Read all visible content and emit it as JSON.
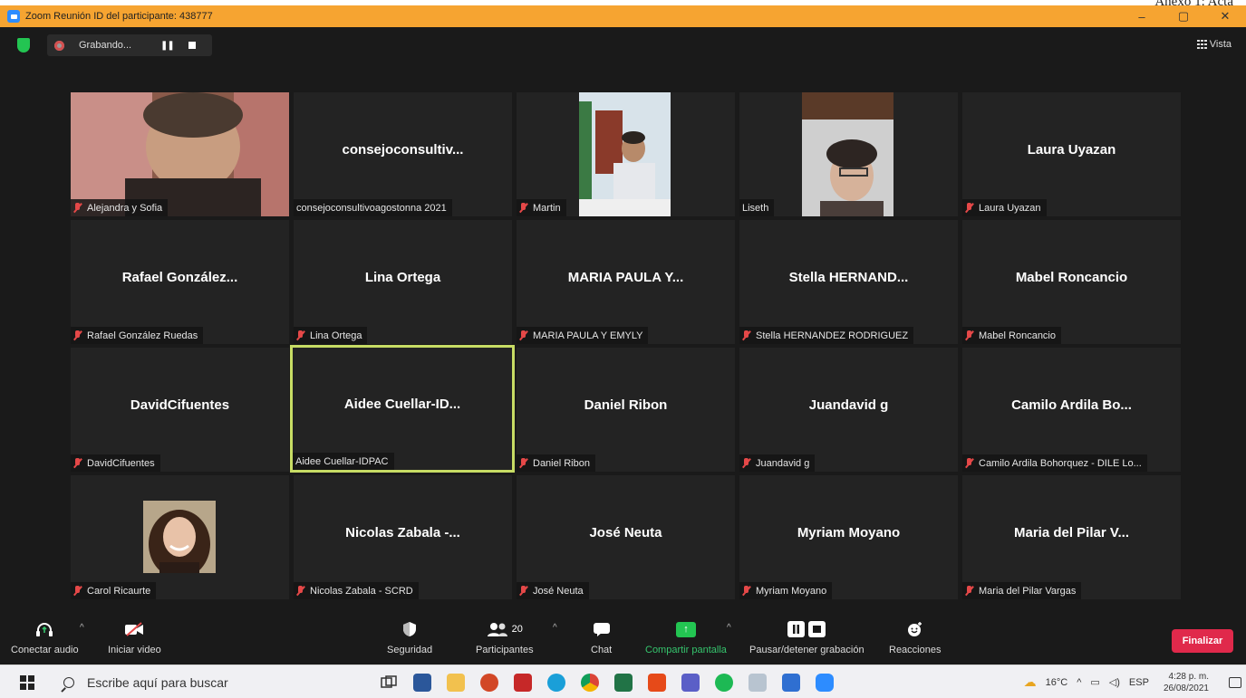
{
  "window": {
    "doc_text": "Anexo 1: Acta",
    "title": "Zoom Reunión ID del participante: 438777",
    "min": "–",
    "max": "▢",
    "close": "✕"
  },
  "top_bar": {
    "recording_text": "Grabando...",
    "view_label": "Vista"
  },
  "tiles": [
    {
      "title": "",
      "label": "Alejandra y Sofia",
      "muted": true
    },
    {
      "title": "consejoconsultiv...",
      "label": "consejoconsultivoagostonna 2021",
      "muted": false
    },
    {
      "title": "",
      "label": "Martin",
      "muted": true
    },
    {
      "title": "",
      "label": "Liseth",
      "muted": false
    },
    {
      "title": "Laura Uyazan",
      "label": "Laura Uyazan",
      "muted": true
    },
    {
      "title": "Rafael González...",
      "label": "Rafael González Ruedas",
      "muted": true
    },
    {
      "title": "Lina Ortega",
      "label": "Lina Ortega",
      "muted": true
    },
    {
      "title": "MARIA PAULA Y...",
      "label": "MARIA PAULA Y EMYLY",
      "muted": true
    },
    {
      "title": "Stella HERNAND...",
      "label": "Stella HERNANDEZ RODRIGUEZ",
      "muted": true
    },
    {
      "title": "Mabel Roncancio",
      "label": "Mabel Roncancio",
      "muted": true
    },
    {
      "title": "DavidCifuentes",
      "label": "DavidCifuentes",
      "muted": true
    },
    {
      "title": "Aidee Cuellar-ID...",
      "label": "Aidee Cuellar-IDPAC",
      "muted": false
    },
    {
      "title": "Daniel Ribon",
      "label": "Daniel Ribon",
      "muted": true
    },
    {
      "title": "Juandavid g",
      "label": "Juandavid g",
      "muted": true
    },
    {
      "title": "Camilo Ardila Bo...",
      "label": "Camilo Ardila Bohorquez - DILE Lo...",
      "muted": true
    },
    {
      "title": "",
      "label": "Carol Ricaurte",
      "muted": true
    },
    {
      "title": "Nicolas Zabala -...",
      "label": "Nicolas Zabala - SCRD",
      "muted": true
    },
    {
      "title": "José Neuta",
      "label": "José Neuta",
      "muted": true
    },
    {
      "title": "Myriam Moyano",
      "label": "Myriam Moyano",
      "muted": true
    },
    {
      "title": "Maria del Pilar V...",
      "label": "Maria del Pilar Vargas",
      "muted": true
    }
  ],
  "toolbar": {
    "audio_label": "Conectar audio",
    "video_label": "Iniciar video",
    "security_label": "Seguridad",
    "participants_label": "Participantes",
    "participants_count": "20",
    "chat_label": "Chat",
    "share_label": "Compartir pantalla",
    "recording_label": "Pausar/detener grabación",
    "reactions_label": "Reacciones",
    "end_label": "Finalizar"
  },
  "taskbar": {
    "search_placeholder": "Escribe aquí para buscar",
    "weather": "16°C",
    "language": "ESP",
    "time": "4:28 p. m.",
    "date": "26/08/2021"
  },
  "colors": {
    "titlebar": "#f6a431",
    "active_speaker": "#c7dc64",
    "share_green": "#23c552",
    "end_red": "#e0294b"
  }
}
